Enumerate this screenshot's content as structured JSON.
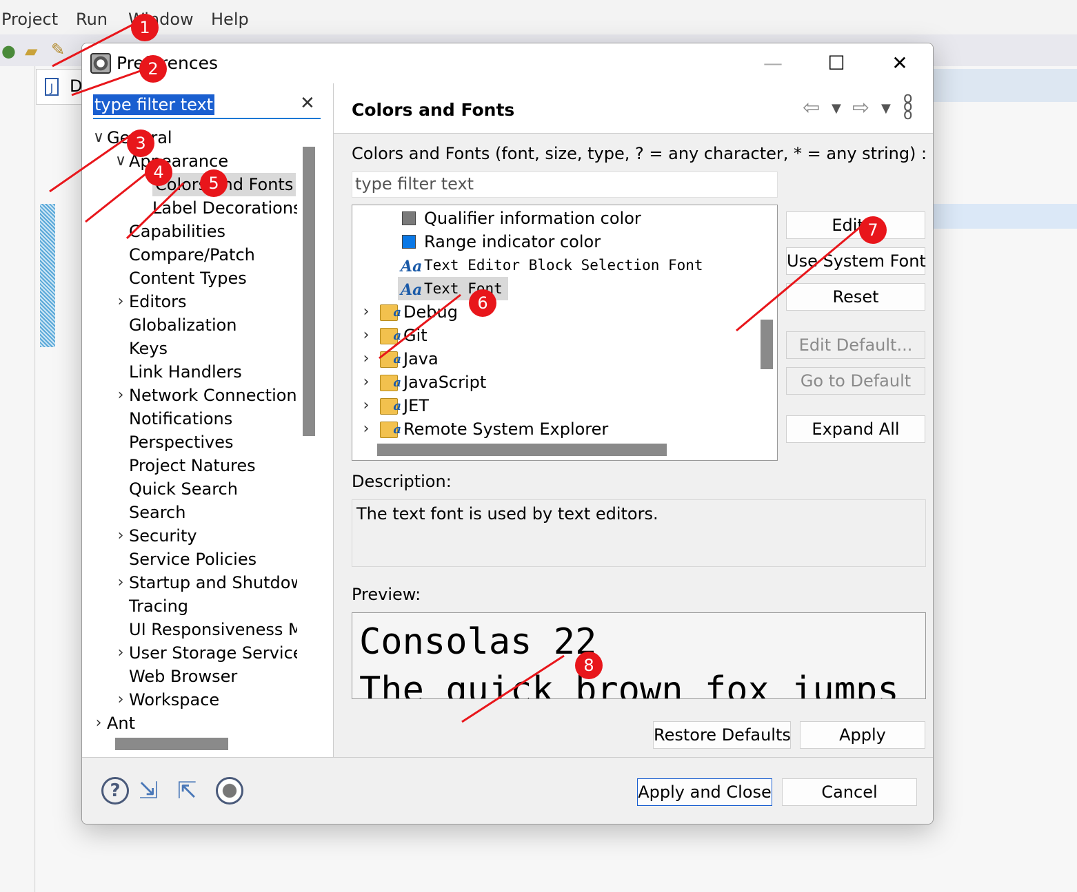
{
  "ide": {
    "menu": [
      "Project",
      "Run",
      "Window",
      "Help"
    ],
    "editor_tab_letter": "D"
  },
  "dialog": {
    "title": "Preferences",
    "buttons": {
      "minimize": "—",
      "maximize": "☐",
      "close": "✕"
    }
  },
  "left": {
    "filter_text": "type filter text",
    "tree": [
      {
        "label": "General",
        "expanded": true,
        "level": 0
      },
      {
        "label": "Appearance",
        "expanded": true,
        "level": 1
      },
      {
        "label": "Colors and Fonts",
        "level": 2,
        "selected": true
      },
      {
        "label": "Label Decorations",
        "level": 2
      },
      {
        "label": "Capabilities",
        "level": 1
      },
      {
        "label": "Compare/Patch",
        "level": 1
      },
      {
        "label": "Content Types",
        "level": 1
      },
      {
        "label": "Editors",
        "level": 1,
        "expandable": true
      },
      {
        "label": "Globalization",
        "level": 1
      },
      {
        "label": "Keys",
        "level": 1
      },
      {
        "label": "Link Handlers",
        "level": 1
      },
      {
        "label": "Network Connections",
        "level": 1,
        "expandable": true
      },
      {
        "label": "Notifications",
        "level": 1
      },
      {
        "label": "Perspectives",
        "level": 1
      },
      {
        "label": "Project Natures",
        "level": 1
      },
      {
        "label": "Quick Search",
        "level": 1
      },
      {
        "label": "Search",
        "level": 1
      },
      {
        "label": "Security",
        "level": 1,
        "expandable": true
      },
      {
        "label": "Service Policies",
        "level": 1
      },
      {
        "label": "Startup and Shutdown",
        "level": 1,
        "expandable": true
      },
      {
        "label": "Tracing",
        "level": 1
      },
      {
        "label": "UI Responsiveness Monitoring",
        "level": 1
      },
      {
        "label": "User Storage Service",
        "level": 1,
        "expandable": true
      },
      {
        "label": "Web Browser",
        "level": 1
      },
      {
        "label": "Workspace",
        "level": 1,
        "expandable": true
      },
      {
        "label": "Ant",
        "level": 0,
        "expandable": true
      }
    ]
  },
  "right": {
    "title": "Colors and Fonts",
    "hint": "Colors and Fonts (font, size, type, ? = any character, * = any string) :",
    "filter_placeholder": "type filter text",
    "list": [
      {
        "label": "Qualifier information color",
        "kind": "color",
        "color": "#7a7a7a"
      },
      {
        "label": "Range indicator color",
        "kind": "color",
        "color": "#0a78e6"
      },
      {
        "label": "Text Editor Block Selection Font",
        "kind": "font"
      },
      {
        "label": "Text Font",
        "kind": "font",
        "selected": true
      },
      {
        "label": "Debug",
        "kind": "category"
      },
      {
        "label": "Git",
        "kind": "category"
      },
      {
        "label": "Java",
        "kind": "category"
      },
      {
        "label": "JavaScript",
        "kind": "category"
      },
      {
        "label": "JET",
        "kind": "category"
      },
      {
        "label": "Remote System Explorer",
        "kind": "category"
      }
    ],
    "font_icon": "Aa",
    "buttons": {
      "edit": "Edit...",
      "use_system_font": "Use System Font",
      "reset": "Reset",
      "edit_default": "Edit Default...",
      "go_to_default": "Go to Default",
      "expand_all": "Expand All"
    },
    "description_label": "Description:",
    "description": "The text font is used by text editors.",
    "preview_label": "Preview:",
    "preview_lines": [
      "Consolas 22",
      "The quick brown fox jumps"
    ],
    "restore_defaults": "Restore Defaults",
    "apply": "Apply"
  },
  "footer": {
    "apply_and_close": "Apply and Close",
    "cancel": "Cancel"
  },
  "annotations": [
    "1",
    "2",
    "3",
    "4",
    "5",
    "6",
    "7",
    "8"
  ],
  "colors": {
    "accent": "#1a5fd0",
    "annotation": "#e8161b"
  }
}
